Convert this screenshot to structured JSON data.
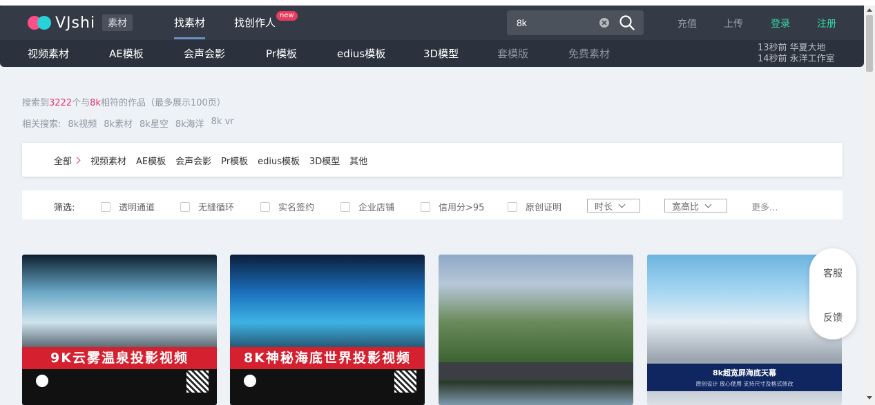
{
  "header": {
    "logo_text": "VJshi",
    "logo_badge": "素材",
    "nav": {
      "find_material": "找素材",
      "find_creators": "找创作人",
      "new_badge": "new"
    },
    "search": {
      "value": "8k"
    },
    "links": {
      "recharge": "充值",
      "upload": "上传",
      "login": "登录",
      "register": "注册"
    },
    "categories": [
      "视频素材",
      "AE模板",
      "会声会影",
      "Pr模板",
      "edius模板",
      "3D模型",
      "套模版",
      "免费素材"
    ],
    "ticker": [
      "13秒前 华夏大地",
      "14秒前 永洋工作室"
    ]
  },
  "results": {
    "summary_prefix": "搜索到",
    "summary_count": "3222",
    "summary_mid": "个与",
    "summary_term": "8k",
    "summary_suffix": "相符的作品（最多展示100页）",
    "related_label": "相关搜索:",
    "related": [
      "8k视频",
      "8k素材",
      "8k星空",
      "8k海洋",
      "8k vr"
    ]
  },
  "breadcrumb": {
    "root": "全部",
    "items": [
      "视频素材",
      "AE模板",
      "会声会影",
      "Pr模板",
      "edius模板",
      "3D模型",
      "其他"
    ]
  },
  "filters": {
    "label": "筛选:",
    "checkboxes": [
      "透明通道",
      "无缝循环",
      "实名签约",
      "企业店铺",
      "信用分>95",
      "原创证明"
    ],
    "dropdowns": [
      "时长",
      "宽高比"
    ],
    "more": "更多..."
  },
  "cards": [
    {
      "title": "9K云雾温泉投影视频"
    },
    {
      "title": "8K神秘海底世界投影视频"
    },
    {
      "title": ""
    },
    {
      "title": "8k超宽屏海底天幕",
      "subtitle": "原创设计  放心使用  支持尺寸及格式修改"
    }
  ],
  "service": {
    "customer": "客服",
    "feedback": "反馈"
  },
  "colors": {
    "accent": "#e8336d",
    "green": "#35d6a4",
    "header_bg": "#2b323d"
  }
}
